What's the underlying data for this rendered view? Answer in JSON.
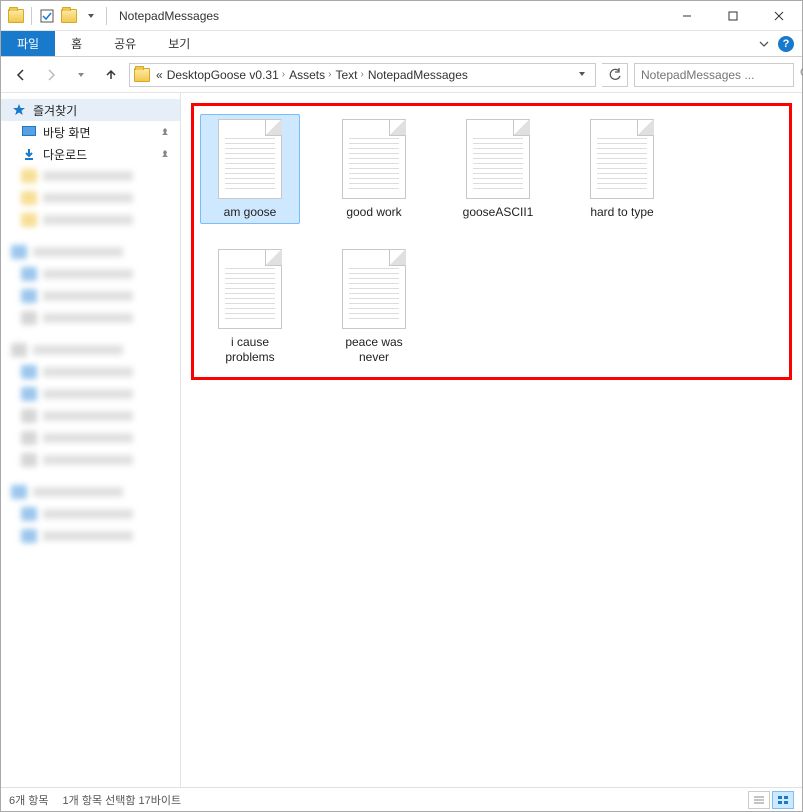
{
  "window": {
    "title": "NotepadMessages"
  },
  "ribbon": {
    "file": "파일",
    "home": "홈",
    "share": "공유",
    "view": "보기"
  },
  "breadcrumb": {
    "prefix": "«",
    "items": [
      "DesktopGoose v0.31",
      "Assets",
      "Text",
      "NotepadMessages"
    ]
  },
  "search": {
    "placeholder": "NotepadMessages ..."
  },
  "sidebar": {
    "quick_access": "즐겨찾기",
    "desktop": "바탕 화면",
    "downloads": "다운로드"
  },
  "files": [
    {
      "name": "am goose",
      "selected": true
    },
    {
      "name": "good work",
      "selected": false
    },
    {
      "name": "gooseASCII1",
      "selected": false
    },
    {
      "name": "hard to type",
      "selected": false
    },
    {
      "name": "i cause problems",
      "selected": false
    },
    {
      "name": "peace was never",
      "selected": false
    }
  ],
  "status": {
    "count": "6개 항목",
    "selection": "1개 항목 선택함 17바이트"
  }
}
